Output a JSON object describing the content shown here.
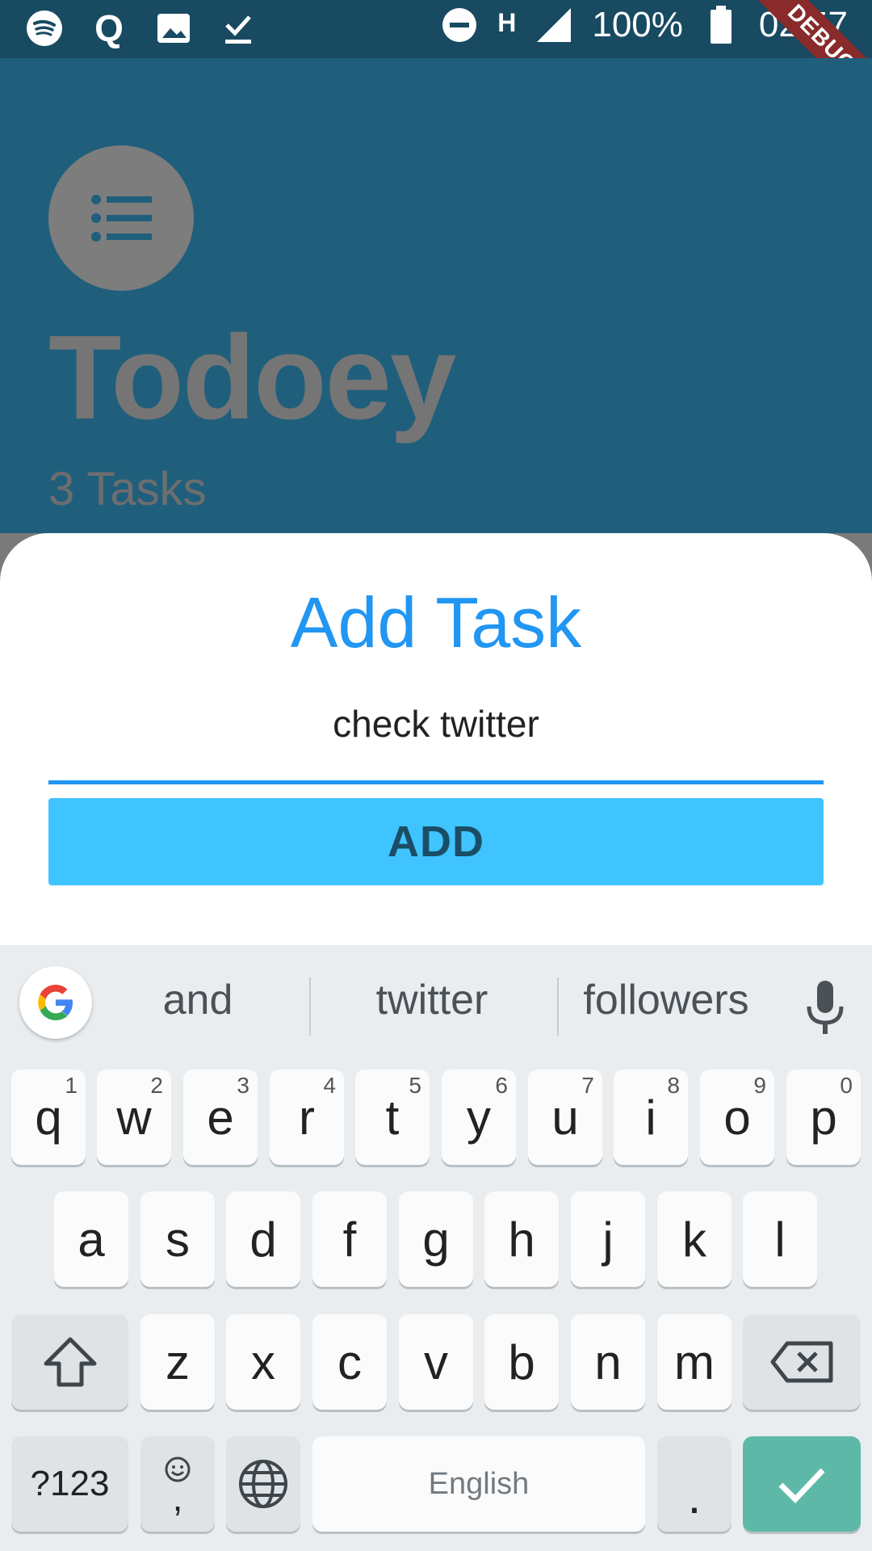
{
  "status_bar": {
    "left_icons": [
      "spotify-icon",
      "q-icon",
      "image-icon",
      "download-done-icon"
    ],
    "dnd_icon": "do-not-disturb-icon",
    "network_label": "H",
    "signal_icon": "signal-icon",
    "battery_percent": "100%",
    "battery_icon": "battery-icon",
    "time": "02:57"
  },
  "debug_ribbon": "DEBUG",
  "header": {
    "title": "Todoey",
    "task_count": "3 Tasks"
  },
  "sheet": {
    "title": "Add Task",
    "input_value": "check twitter",
    "add_label": "ADD"
  },
  "keyboard": {
    "suggestions": [
      "and",
      "twitter",
      "followers"
    ],
    "row1": [
      {
        "key": "q",
        "hint": "1"
      },
      {
        "key": "w",
        "hint": "2"
      },
      {
        "key": "e",
        "hint": "3"
      },
      {
        "key": "r",
        "hint": "4"
      },
      {
        "key": "t",
        "hint": "5"
      },
      {
        "key": "y",
        "hint": "6"
      },
      {
        "key": "u",
        "hint": "7"
      },
      {
        "key": "i",
        "hint": "8"
      },
      {
        "key": "o",
        "hint": "9"
      },
      {
        "key": "p",
        "hint": "0"
      }
    ],
    "row2": [
      "a",
      "s",
      "d",
      "f",
      "g",
      "h",
      "j",
      "k",
      "l"
    ],
    "row3": [
      "z",
      "x",
      "c",
      "v",
      "b",
      "n",
      "m"
    ],
    "symbols_label": "?123",
    "emoji_comma_label": ",",
    "space_label": "English",
    "period_label": "."
  },
  "colors": {
    "header_bg": "#1f5f7c",
    "accent": "#2196f3",
    "button": "#40c4ff",
    "enter_key": "#5eb8a8"
  }
}
